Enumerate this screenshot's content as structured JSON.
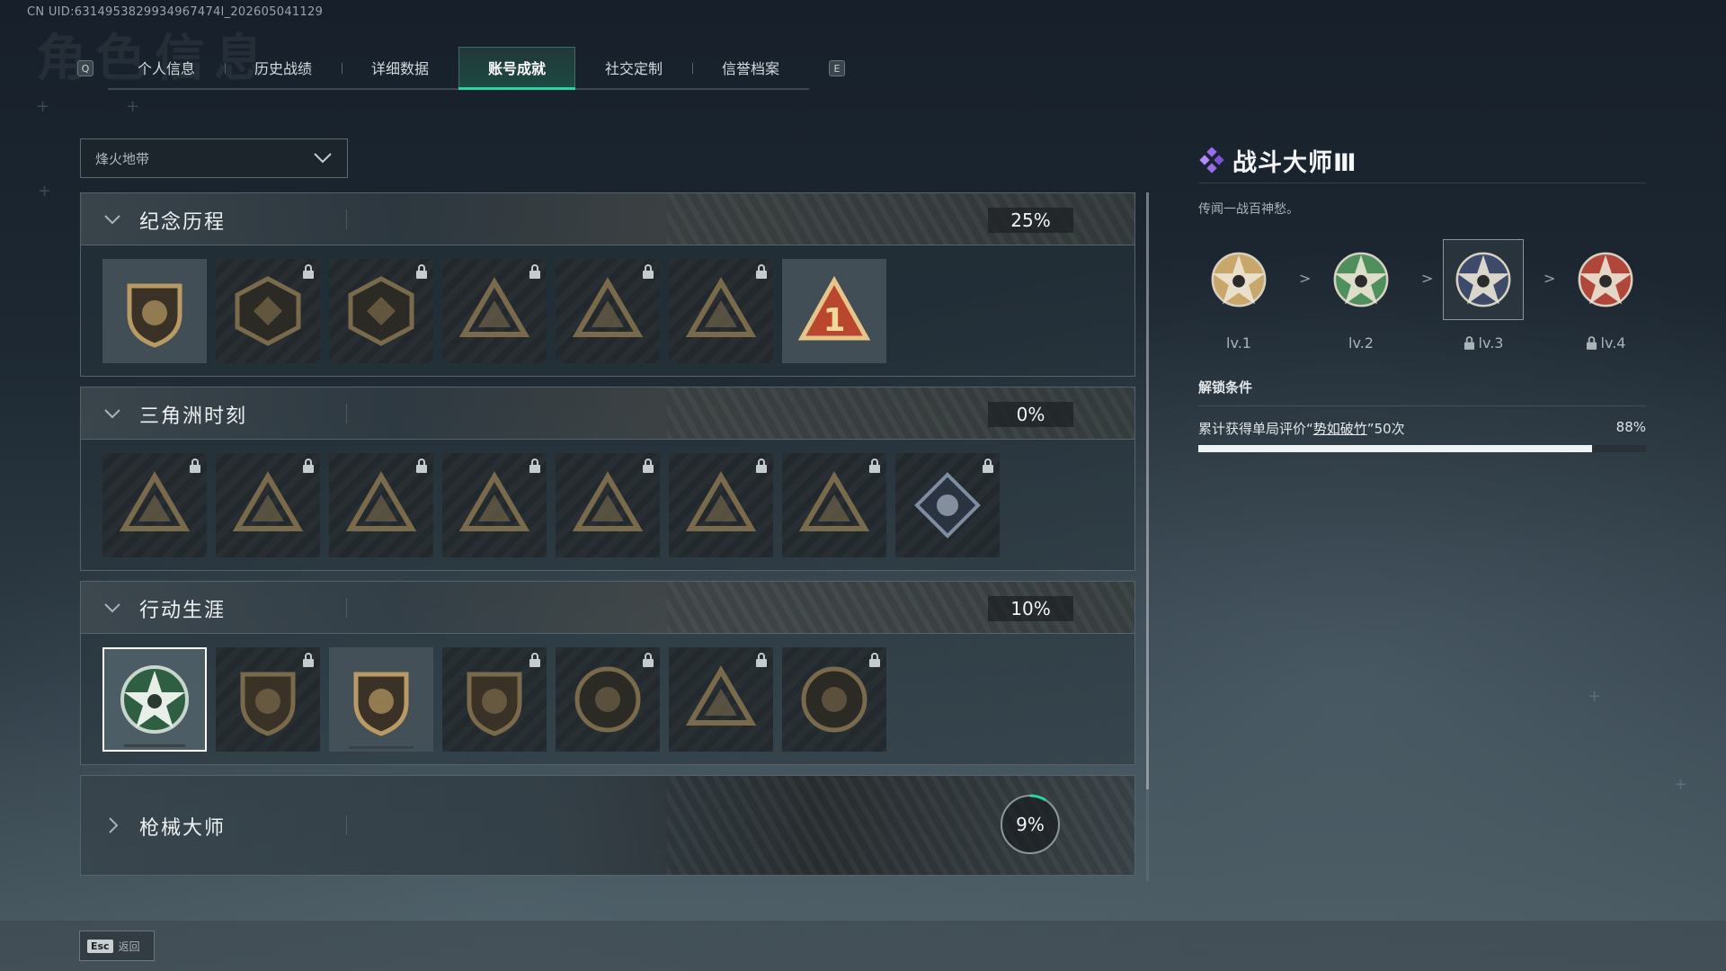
{
  "uid": "CN UID:6314953829934967474l_202605041129",
  "ghost_title": "角色信息",
  "tabs": {
    "left_key": "Q",
    "right_key": "E",
    "items": [
      "个人信息",
      "历史战绩",
      "详细数据",
      "账号成就",
      "社交定制",
      "信誉档案"
    ],
    "active_index": 3
  },
  "filter": {
    "selected": "烽火地带"
  },
  "categories": [
    {
      "title": "纪念历程",
      "progress": "25%",
      "expanded": true,
      "badges": [
        {
          "icon": "triangle-shield-badge",
          "locked": false
        },
        {
          "icon": "helicopter-badge",
          "locked": true
        },
        {
          "icon": "diamond-shield-badge",
          "locked": true
        },
        {
          "icon": "tower-badge",
          "locked": true
        },
        {
          "icon": "soldier-triangle-badge",
          "locked": true
        },
        {
          "icon": "crossed-skull-badge",
          "locked": true
        },
        {
          "icon": "number-one-triangle-badge",
          "locked": false
        }
      ]
    },
    {
      "title": "三角洲时刻",
      "progress": "0%",
      "expanded": true,
      "badges": [
        {
          "icon": "bottle-triangle-badge",
          "locked": true
        },
        {
          "icon": "mask-triangle-badge",
          "locked": true
        },
        {
          "icon": "mermaid-triangle-badge",
          "locked": true
        },
        {
          "icon": "dice-triangle-badge",
          "locked": true
        },
        {
          "icon": "runner-triangle-badge",
          "locked": true
        },
        {
          "icon": "team-triangle-badge",
          "locked": true
        },
        {
          "icon": "fish-triangle-badge",
          "locked": true
        },
        {
          "icon": "rose-diamond-badge",
          "locked": true
        }
      ]
    },
    {
      "title": "行动生涯",
      "progress": "10%",
      "expanded": true,
      "badges": [
        {
          "icon": "star-skull-badge",
          "locked": false,
          "selected": true
        },
        {
          "icon": "eagle-shield-badge",
          "locked": true
        },
        {
          "icon": "emblem-shield-badge",
          "locked": false
        },
        {
          "icon": "dice-shield-badge",
          "locked": true
        },
        {
          "icon": "planet-circle-badge",
          "locked": true
        },
        {
          "icon": "crosshair-skull-badge",
          "locked": true
        },
        {
          "icon": "eye-circle-badge",
          "locked": true
        }
      ]
    },
    {
      "title": "枪械大师",
      "progress": "9%",
      "expanded": false,
      "progress_value": 0.09
    }
  ],
  "detail": {
    "name": "战斗大师Ⅲ",
    "description": "传闻一战百神愁。",
    "levels": [
      {
        "label": "lv.1",
        "locked": false,
        "color": "#c9a76a"
      },
      {
        "label": "lv.2",
        "locked": false,
        "color": "#4f8f5e"
      },
      {
        "label": "lv.3",
        "locked": true,
        "current": true,
        "color": "#3d4a6a"
      },
      {
        "label": "lv.4",
        "locked": true,
        "color": "#b0473a"
      }
    ],
    "arrow": ">",
    "unlock_title": "解锁条件",
    "condition_prefix": "累计获得单局评价“",
    "condition_key": "势如破竹",
    "condition_suffix": "”50次",
    "condition_percent": "88%",
    "condition_value": 0.88
  },
  "footer": {
    "esc_key": "Esc",
    "esc_label": "返回"
  },
  "colors": {
    "accent": "#27d6a0",
    "purple": "#9b6cf0"
  }
}
